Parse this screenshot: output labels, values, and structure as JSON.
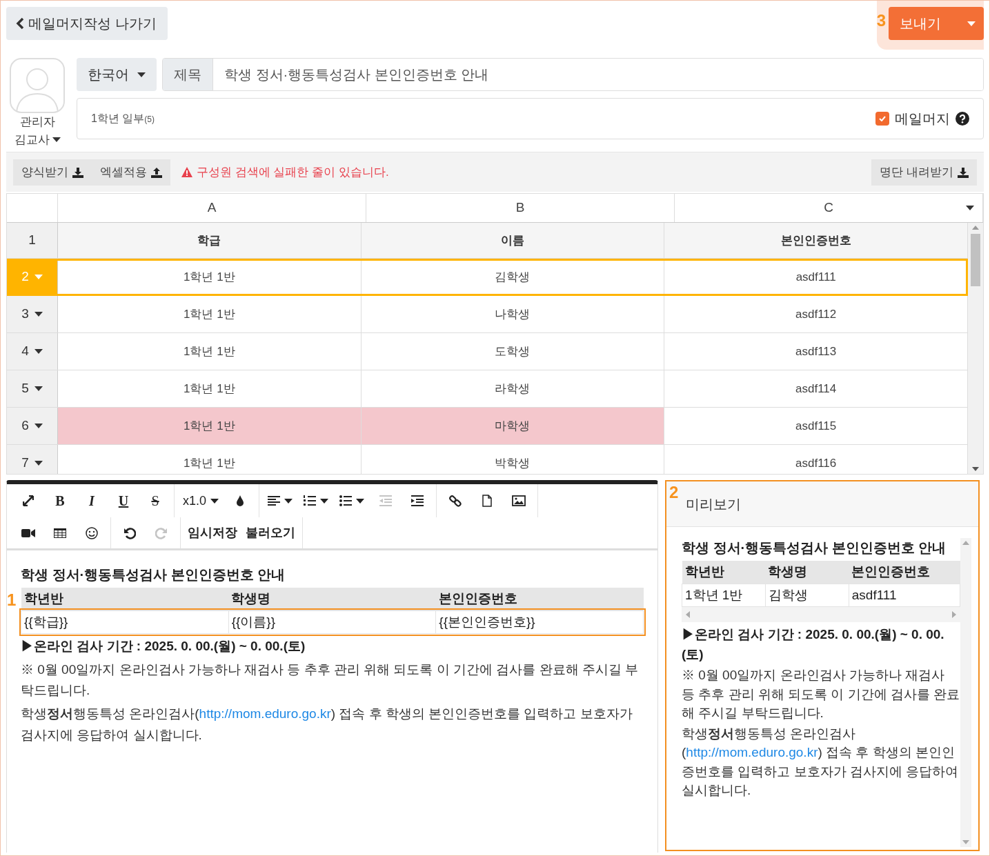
{
  "back_button": {
    "label": "메일머지작성 나가기"
  },
  "send": {
    "callout": "3",
    "label": "보내기"
  },
  "sender": {
    "role": "관리자",
    "name": "김교사"
  },
  "language": "한국어",
  "subject": {
    "label": "제목",
    "value": "학생 정서·행동특성검사 본인인증번호 안내"
  },
  "recipients": {
    "text": "1학년 일부",
    "count": "(5)"
  },
  "mail_merge": {
    "label": "메일머지",
    "checked": true
  },
  "sheet_toolbar": {
    "buttons": [
      {
        "label": "양식받기",
        "kind": "download"
      },
      {
        "label": "엑셀적용",
        "kind": "upload"
      }
    ],
    "warning": "구성원 검색에 실패한 줄이 있습니다.",
    "export_button": {
      "label": "명단 내려받기"
    }
  },
  "sheet": {
    "columns": [
      "A",
      "B",
      "C"
    ],
    "header": {
      "number": "1",
      "cells": [
        "학급",
        "이름",
        "본인인증번호"
      ]
    },
    "rows": [
      {
        "number": "2",
        "selected": true,
        "cells": [
          {
            "text": "1학년 1반",
            "flagged": false
          },
          {
            "text": "김학생",
            "flagged": false
          },
          {
            "text": "asdf111",
            "flagged": false
          }
        ]
      },
      {
        "number": "3",
        "selected": false,
        "cells": [
          {
            "text": "1학년 1반",
            "flagged": false
          },
          {
            "text": "나학생",
            "flagged": false
          },
          {
            "text": "asdf112",
            "flagged": false
          }
        ]
      },
      {
        "number": "4",
        "selected": false,
        "cells": [
          {
            "text": "1학년 1반",
            "flagged": false
          },
          {
            "text": "도학생",
            "flagged": false
          },
          {
            "text": "asdf113",
            "flagged": false
          }
        ]
      },
      {
        "number": "5",
        "selected": false,
        "cells": [
          {
            "text": "1학년 1반",
            "flagged": false
          },
          {
            "text": "라학생",
            "flagged": false
          },
          {
            "text": "asdf114",
            "flagged": false
          }
        ]
      },
      {
        "number": "6",
        "selected": false,
        "cells": [
          {
            "text": "1학년 1반",
            "flagged": true
          },
          {
            "text": "마학생",
            "flagged": true
          },
          {
            "text": "asdf115",
            "flagged": false
          }
        ]
      },
      {
        "number": "7",
        "selected": false,
        "cells": [
          {
            "text": "1학년 1반",
            "flagged": false
          },
          {
            "text": "박학생",
            "flagged": false
          },
          {
            "text": "asdf116",
            "flagged": false
          }
        ]
      }
    ]
  },
  "editor": {
    "toolbar": [
      [
        [
          {
            "kind": "fullscreen",
            "disabled": false
          },
          {
            "kind": "bold",
            "label": "B",
            "disabled": false
          },
          {
            "kind": "italic",
            "label": "I",
            "disabled": false
          },
          {
            "kind": "underline",
            "label": "U",
            "disabled": false
          },
          {
            "kind": "strike",
            "label": "S",
            "disabled": false
          }
        ],
        [
          {
            "kind": "font-size",
            "label": "x1.0",
            "disabled": false
          },
          {
            "kind": "color",
            "disabled": false
          }
        ],
        [
          {
            "kind": "align",
            "disabled": false
          },
          {
            "kind": "ordered-list",
            "disabled": false
          },
          {
            "kind": "unordered-list",
            "disabled": false
          },
          {
            "kind": "outdent",
            "disabled": true
          },
          {
            "kind": "indent",
            "disabled": false
          }
        ],
        [
          {
            "kind": "link",
            "disabled": false
          },
          {
            "kind": "file",
            "disabled": false
          },
          {
            "kind": "image",
            "disabled": false
          }
        ]
      ],
      [
        [
          {
            "kind": "video",
            "disabled": false
          },
          {
            "kind": "table",
            "disabled": false
          },
          {
            "kind": "emoji",
            "disabled": false
          }
        ],
        [
          {
            "kind": "undo",
            "disabled": false
          },
          {
            "kind": "redo",
            "disabled": true
          }
        ],
        [
          {
            "kind": "text",
            "label": "임시저장",
            "disabled": false
          },
          {
            "kind": "text",
            "label": "불러오기",
            "disabled": false
          }
        ]
      ]
    ],
    "content": {
      "title": "학생 정서·행동특성검사 본인인증번호 안내",
      "table": {
        "headers": [
          "학년반",
          "학생명",
          "본인인증번호"
        ],
        "callout": "1",
        "row": [
          "{{학급}}",
          "{{이름}}",
          "{{본인인증번호}}"
        ]
      },
      "period": "▶온라인 검사 기간 :  2025. 0. 00.(월) ~ 0. 00.(토)",
      "notice": "※ 0월 00일까지 온라인검사 가능하나 재검사 등 추후 관리 위해 되도록 이 기간에 검사를 완료해 주시길 부탁드립니다.",
      "paragraph": {
        "before": "학생**정서**행동특성 온라인검사(",
        "link": "http://mom.eduro.go.kr",
        "after": ") 접속 후 학생의 본인인증번호를 입력하고 보호자가 검사지에 응답하여 실시합니다."
      }
    }
  },
  "preview": {
    "callout": "2",
    "title": "미리보기",
    "content": {
      "title": "학생 정서·행동특성검사 본인인증번호 안내",
      "table": {
        "headers": [
          "학년반",
          "학생명",
          "본인인증번호"
        ],
        "row": [
          "1학년 1반",
          "김학생",
          "asdf111"
        ]
      },
      "period": "▶온라인 검사 기간 :  2025. 0. 00.(월) ~ 0. 00.(토)",
      "notice": "※ 0월 00일까지 온라인검사 가능하나 재검사 등 추후 관리 위해 되도록 이 기간에 검사를 완료해 주시길 부탁드립니다.",
      "paragraph": {
        "before": "학생**정서**행동특성 온라인검사(",
        "link": "http://mom.eduro.go.kr",
        "after": ") 접속 후 학생의 본인인증번호를 입력하고 보호자가 검사지에 응답하여 실시합니다."
      }
    }
  }
}
